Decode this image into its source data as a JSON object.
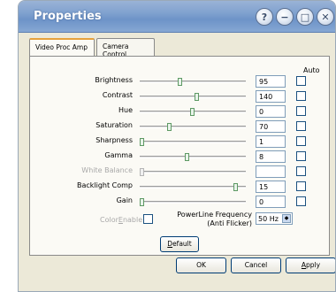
{
  "window": {
    "title": "Properties"
  },
  "titlebar_buttons": {
    "help": "?",
    "minimize": "−",
    "maximize": "□",
    "close": "✕"
  },
  "tabs": [
    {
      "label": "Video Proc Amp",
      "active": true
    },
    {
      "label": "Camera Control",
      "active": false
    }
  ],
  "auto_label": "Auto",
  "rows": [
    {
      "label": "Brightness",
      "value": "95",
      "slider_percent": 38,
      "enabled": true
    },
    {
      "label": "Contrast",
      "value": "140",
      "slider_percent": 54,
      "enabled": true
    },
    {
      "label": "Hue",
      "value": "0",
      "slider_percent": 50,
      "enabled": true
    },
    {
      "label": "Saturation",
      "value": "70",
      "slider_percent": 27,
      "enabled": true
    },
    {
      "label": "Sharpness",
      "value": "1",
      "slider_percent": 0,
      "enabled": true
    },
    {
      "label": "Gamma",
      "value": "8",
      "slider_percent": 45,
      "enabled": true
    },
    {
      "label": "White Balance",
      "value": "",
      "slider_percent": 0,
      "enabled": false
    },
    {
      "label": "Backlight Comp",
      "value": "15",
      "slider_percent": 93,
      "enabled": true
    },
    {
      "label": "Gain",
      "value": "0",
      "slider_percent": 0,
      "enabled": true
    }
  ],
  "color_enable": {
    "label_prefix": "Color",
    "label_underlined": "E",
    "label_suffix": "nable"
  },
  "powerline": {
    "line1": "PowerLine Frequency",
    "line2": "(Anti Flicker)",
    "value": "50 Hz"
  },
  "buttons": {
    "default_u": "D",
    "default_rest": "efault",
    "ok": "OK",
    "cancel": "Cancel",
    "apply_u": "A",
    "apply_rest": "pply"
  }
}
